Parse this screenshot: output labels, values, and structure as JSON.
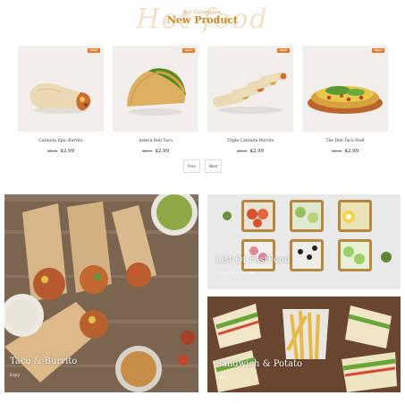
{
  "header": {
    "watermark": "Hot food",
    "kicker": "All Collection",
    "title": "New Product"
  },
  "products": [
    {
      "name": "Carnaita Epic Burrito",
      "old_price": "$4.00",
      "price": "$2.99",
      "badge": "SALE"
    },
    {
      "name": "Asteca Dell Taco",
      "old_price": "$4.00",
      "price": "$2.99",
      "badge": "SALE"
    },
    {
      "name": "Triple Carnaita Burrito",
      "old_price": "$4.00",
      "price": "$2.99",
      "badge": "SALE"
    },
    {
      "name": "The Dell Taco Stall",
      "old_price": "$4.00",
      "price": "$2.99",
      "badge": "SALE"
    }
  ],
  "pagination": {
    "prev": "Prev",
    "next": "Next"
  },
  "banners": {
    "left": {
      "title": "Taco & Burrito",
      "sub": "Enjoy"
    },
    "top_right": {
      "title": "List Of FastFood",
      "sub": "Choose What You Like"
    },
    "bottom_right": {
      "title": "Sandwich & Potato",
      "sub": "Enjoy"
    }
  },
  "colors": {
    "accent": "#c98b2b",
    "badge": "#e77a2a"
  }
}
